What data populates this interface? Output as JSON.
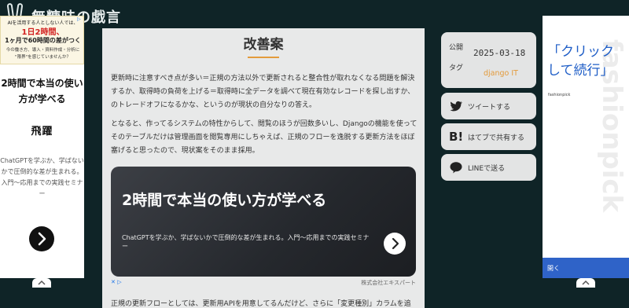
{
  "site": {
    "title": "無糖味の戯言"
  },
  "article": {
    "heading": "改善案",
    "para1": "更新時に注意すべき点が多い＝正規の方法以外で更新されると整合性が取れなくなる問題を解決するか、取得時の負荷を上げる＝取得時に全データを調べて現在有効なレコードを探し出すか、のトレードオフになるかな、というのが現状の自分なりの答え。",
    "para2": "となると、作ってるシステムの特性からして、閲覧のほうが回数多いし、Djangoの機能を使ってそのテーブルだけは管理画面を閲覧専用にしちゃえば、正規のフローを逸脱する更新方法をほぼ塞げると思ったので、現状案をそのまま採用。",
    "para3": "正規の更新フローとしては、更新用APIを用意してるんだけど、さらに「変更種別」カラムを追"
  },
  "inline_ad": {
    "title": "2時間で本当の使い方が学べる",
    "description": "ChatGPTを学ぶか、学ばないかで圧倒的な差が生まれる。入門〜応用までの実践セミナー",
    "adchoices": "✕ ▷",
    "advertiser": "株式会社エキスパート"
  },
  "meta": {
    "published_label": "公開",
    "published_date": "2025-03-18",
    "tag_label": "タグ",
    "tags": "django IT"
  },
  "share": {
    "tweet": "ツイートする",
    "hatena": "はてブで共有する",
    "line": "LINEで送る"
  },
  "left_ad": {
    "banner_line1": "AIを活用する人としない人では、",
    "banner_line2": "1日2時間、",
    "banner_line3": "1ヶ月で60時間の差がつく",
    "banner_line4": "今の働き方、導入・資料作成・分析に",
    "banner_line5": "\"限界\"を感じていませんか？",
    "title": "2時間で本当の使い方が学べる",
    "logo": "飛躍",
    "description": "ChatGPTを学ぶか、学ばないかで圧倒的な差が生まれる。入門〜応用までの実践セミナー"
  },
  "right_ad": {
    "watermark": "fashionpick",
    "title": "「クリックして続行」",
    "brand": "fashionpick",
    "open": "開く"
  }
}
